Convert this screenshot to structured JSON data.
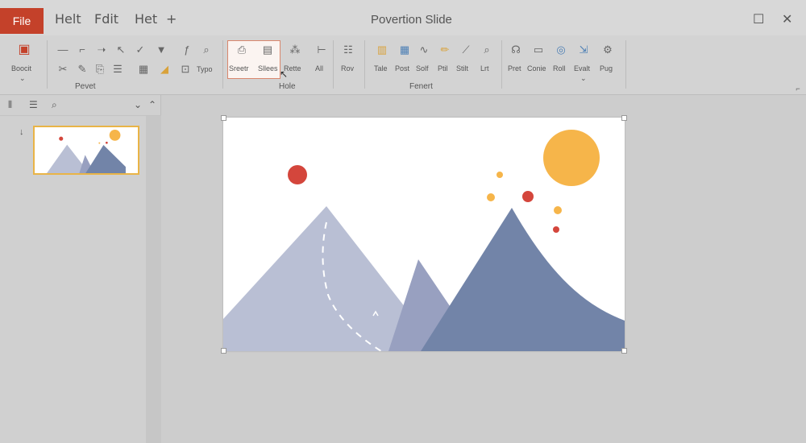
{
  "titlebar": {
    "file_tab": "File",
    "menus": [
      "Helt",
      "Fdit",
      "Het"
    ],
    "add_tab": "+",
    "title": "Povertion Slide",
    "maximize": "☐",
    "close": "✕"
  },
  "ribbon": {
    "groups": [
      "Pevet",
      "Hole",
      "Fenert"
    ],
    "left_button": {
      "label": "Boocit",
      "icon": "book-icon"
    },
    "small_labels": {
      "typo": "Typo"
    },
    "home_buttons": [
      {
        "label": "Sreetr",
        "icon": "slide-icon"
      },
      {
        "label": "Sllees",
        "icon": "layout-icon"
      },
      {
        "label": "Rette",
        "icon": "reset-icon"
      },
      {
        "label": "All",
        "icon": "section-icon"
      }
    ],
    "rov_button": {
      "label": "Rov",
      "icon": "list-icon"
    },
    "insert_buttons": [
      {
        "label": "Tale",
        "icon": "table-icon"
      },
      {
        "label": "Post",
        "icon": "picture-icon"
      },
      {
        "label": "Solf",
        "icon": "shape-icon"
      },
      {
        "label": "Ptil",
        "icon": "pencil-icon"
      },
      {
        "label": "Stilt",
        "icon": "brush-icon"
      },
      {
        "label": "Lrt",
        "icon": "search-icon"
      }
    ],
    "right_buttons": [
      {
        "label": "Pret",
        "icon": "user-icon"
      },
      {
        "label": "Conie",
        "icon": "monitor-icon"
      },
      {
        "label": "Roll",
        "icon": "circle-icon"
      },
      {
        "label": "Evalt",
        "icon": "export-icon"
      },
      {
        "label": "Pug",
        "icon": "plugin-icon"
      }
    ],
    "dropdown_caret": "⌄"
  },
  "left_panel": {
    "slide_number": "↓"
  },
  "colors": {
    "file_tab": "#c4412a",
    "mountain_light": "#b9bfd4",
    "mountain_mid": "#98a0c0",
    "mountain_dark": "#7284a8",
    "sun": "#f6b54a",
    "red_dot": "#d4463c",
    "selection_border": "#d9866d"
  }
}
